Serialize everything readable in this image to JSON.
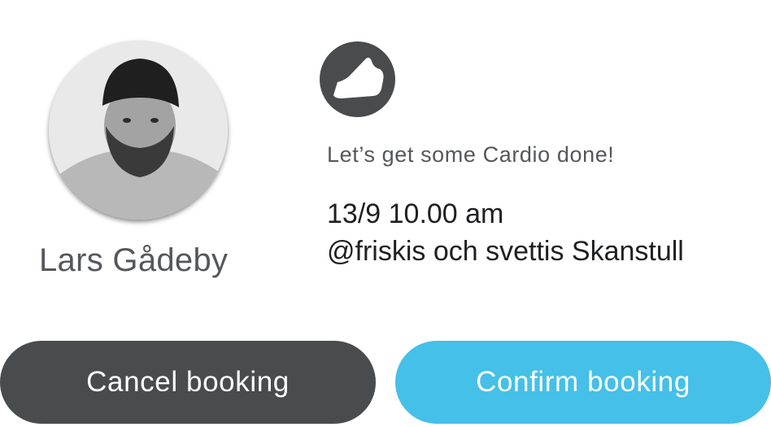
{
  "trainer": {
    "name": "Lars Gådeby",
    "avatar_icon": "person-photo"
  },
  "activity": {
    "icon": "sneaker-icon",
    "tagline": "Let’s get some Cardio done!",
    "datetime": "13/9 10.00 am",
    "location": "@friskis och svettis Skanstull"
  },
  "actions": {
    "cancel_label": "Cancel booking",
    "confirm_label": "Confirm booking"
  },
  "colors": {
    "dark": "#4a4b4d",
    "accent": "#45c0e8"
  }
}
